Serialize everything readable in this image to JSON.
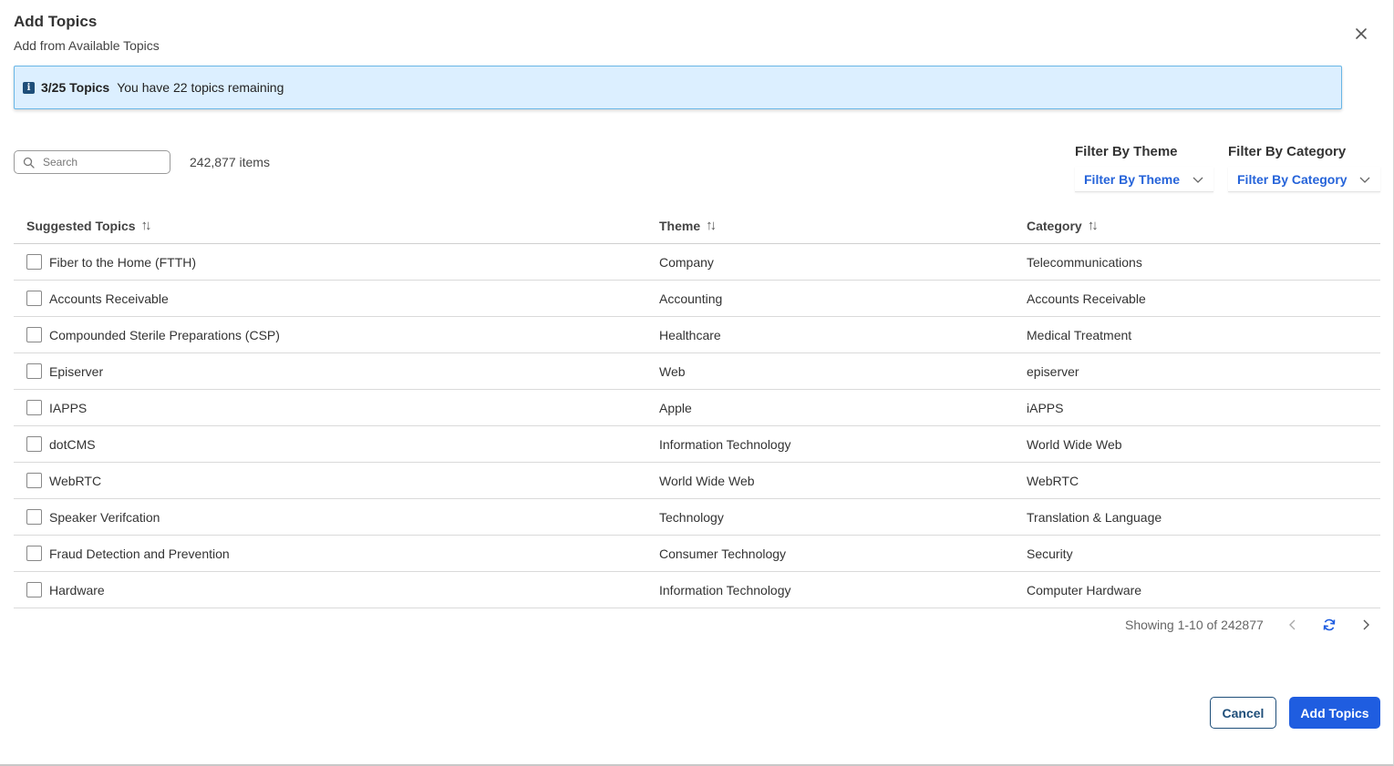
{
  "dialog": {
    "title": "Add Topics",
    "subtitle": "Add from Available Topics"
  },
  "banner": {
    "count": "3/25 Topics",
    "message": "You have 22 topics remaining",
    "icon": "info-icon"
  },
  "search": {
    "placeholder": "Search",
    "value": ""
  },
  "items_count": "242,877 items",
  "filters": {
    "theme": {
      "label": "Filter By Theme",
      "value": "Filter By Theme"
    },
    "category": {
      "label": "Filter By Category",
      "value": "Filter By Category"
    }
  },
  "table": {
    "headers": [
      "Suggested Topics",
      "Theme",
      "Category"
    ],
    "rows": [
      {
        "topic": "Fiber to the Home (FTTH)",
        "theme": "Company",
        "category": "Telecommunications"
      },
      {
        "topic": "Accounts Receivable",
        "theme": "Accounting",
        "category": "Accounts Receivable"
      },
      {
        "topic": "Compounded Sterile Preparations (CSP)",
        "theme": "Healthcare",
        "category": "Medical Treatment"
      },
      {
        "topic": "Episerver",
        "theme": "Web",
        "category": "episerver"
      },
      {
        "topic": "IAPPS",
        "theme": "Apple",
        "category": "iAPPS"
      },
      {
        "topic": "dotCMS",
        "theme": "Information Technology",
        "category": "World Wide Web"
      },
      {
        "topic": "WebRTC",
        "theme": "World Wide Web",
        "category": "WebRTC"
      },
      {
        "topic": "Speaker Verifcation",
        "theme": "Technology",
        "category": "Translation & Language"
      },
      {
        "topic": "Fraud Detection and Prevention",
        "theme": "Consumer Technology",
        "category": "Security"
      },
      {
        "topic": "Hardware",
        "theme": "Information Technology",
        "category": "Computer Hardware"
      }
    ]
  },
  "pagination": {
    "text": "Showing 1-10 of 242877"
  },
  "buttons": {
    "cancel": "Cancel",
    "add": "Add Topics"
  },
  "colors": {
    "accent": "#1f5de0",
    "banner_bg": "#dcefff",
    "banner_border": "#69b6e6",
    "dark_navy": "#1e4e79"
  }
}
